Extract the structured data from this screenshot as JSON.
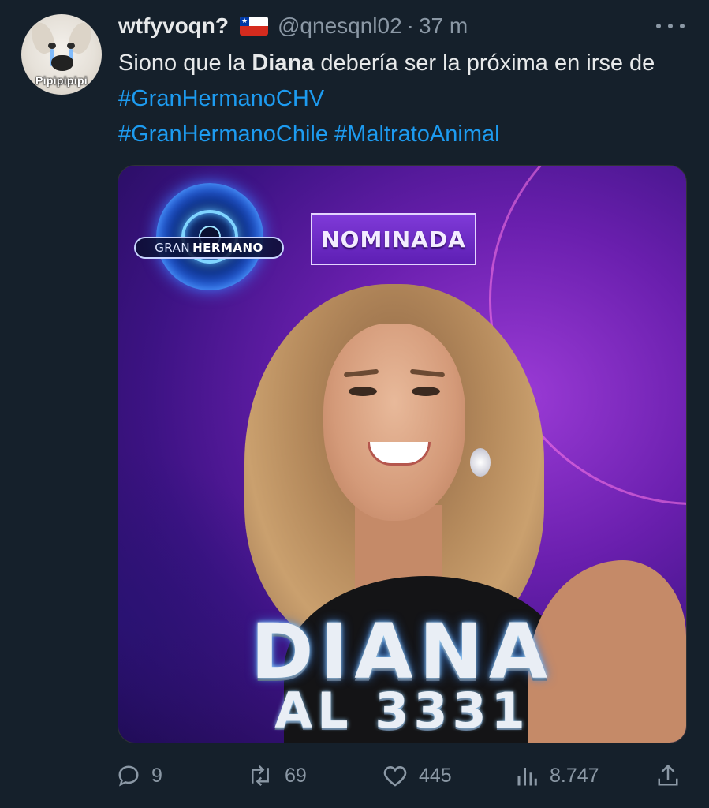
{
  "author": {
    "display_name": "wtfyvoqn?",
    "handle": "@qnesqnl02",
    "separator": "·",
    "time": "37 m",
    "flag_icon": "chile-flag-icon",
    "avatar_caption": "Pipipipipi"
  },
  "tweet": {
    "text_before": "Siono que la ",
    "text_bold": "Diana",
    "text_after": " debería ser la próxima en irse de ",
    "hashtags": [
      "#GranHermanoCHV",
      "#GranHermanoChile",
      "#MaltratoAnimal"
    ]
  },
  "media": {
    "logo_word_1": "GRAN",
    "logo_word_2": "HERMANO",
    "badge": "NOMINADA",
    "name": "DIANA",
    "vote_line": "AL 3331"
  },
  "actions": {
    "reply_count": "9",
    "retweet_count": "69",
    "like_count": "445",
    "views_count": "8.747"
  },
  "colors": {
    "background": "#15202b",
    "hashtag": "#1d9bf0",
    "muted": "#8b98a5",
    "text": "#e7e9ea"
  }
}
